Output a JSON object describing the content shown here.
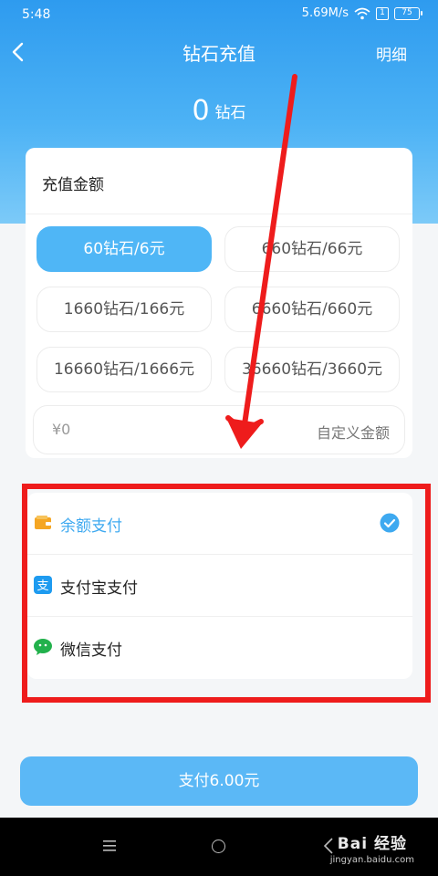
{
  "status_bar": {
    "time": "5:48",
    "speed": "5.69M/s",
    "sim": "1",
    "battery": "75"
  },
  "nav": {
    "title": "钻石充值",
    "detail": "明细"
  },
  "balance": {
    "amount": "0",
    "unit": "钻石"
  },
  "amount_section": {
    "title": "充值金额",
    "options": [
      {
        "label": "60钻石/6元",
        "selected": true
      },
      {
        "label": "660钻石/66元",
        "selected": false
      },
      {
        "label": "1660钻石/166元",
        "selected": false
      },
      {
        "label": "6660钻石/660元",
        "selected": false
      },
      {
        "label": "16660钻石/1666元",
        "selected": false
      },
      {
        "label": "36660钻石/3660元",
        "selected": false
      }
    ],
    "custom": {
      "prefix": "¥0",
      "label": "自定义金额"
    }
  },
  "payment_methods": [
    {
      "label": "余额支付",
      "icon": "wallet-icon",
      "selected": true
    },
    {
      "label": "支付宝支付",
      "icon": "alipay-icon",
      "selected": false
    },
    {
      "label": "微信支付",
      "icon": "wechat-icon",
      "selected": false
    }
  ],
  "pay_button": {
    "label": "支付6.00元"
  },
  "watermark": {
    "main": "Bai 经验",
    "sub": "jingyan.baidu.com"
  },
  "colors": {
    "accent": "#4fb6f6",
    "header": "#2e9bef",
    "annotation_red": "#ee1c1c",
    "balance_pay_icon": "#f5a623",
    "alipay": "#1e9bf0",
    "wechat": "#22b14c"
  }
}
